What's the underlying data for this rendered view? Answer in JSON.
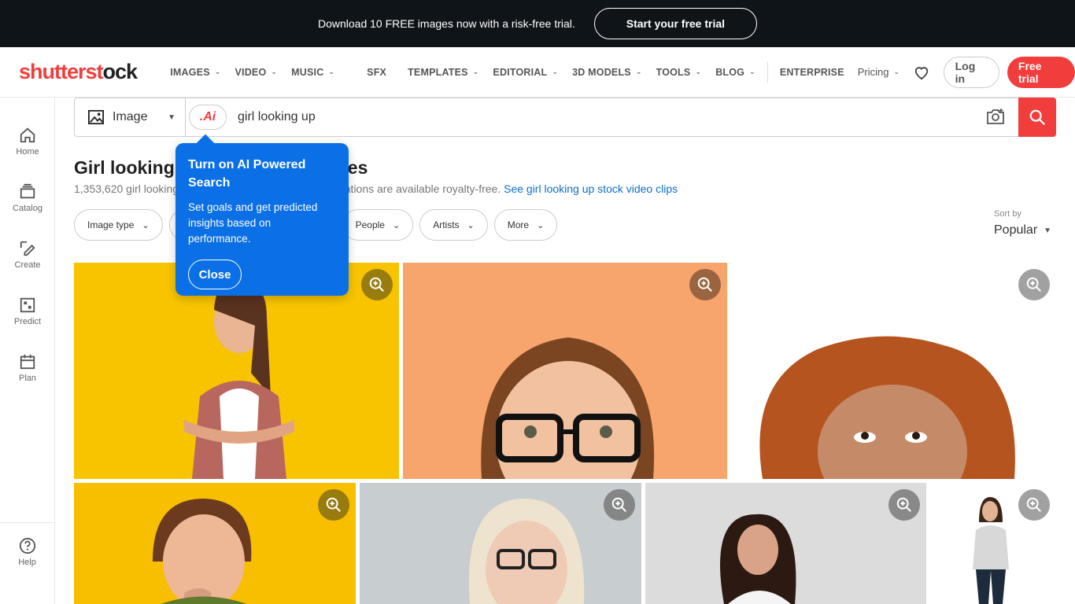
{
  "promo": {
    "text": "Download 10 FREE images now with a risk-free trial.",
    "button": "Start your free trial"
  },
  "header": {
    "logo_a": "shutterst",
    "logo_b": "o",
    "logo_c": "ck",
    "nav": [
      "IMAGES",
      "VIDEO",
      "MUSIC",
      "SFX",
      "TEMPLATES",
      "EDITORIAL",
      "3D MODELS",
      "TOOLS",
      "BLOG"
    ],
    "enterprise": "ENTERPRISE",
    "pricing": "Pricing",
    "login": "Log in",
    "free_trial": "Free trial"
  },
  "sidebar": {
    "items": [
      "Home",
      "Catalog",
      "Create",
      "Predict",
      "Plan"
    ],
    "help": "Help"
  },
  "search": {
    "type": "Image",
    "ai_label": ".Ai",
    "query": "girl looking up"
  },
  "results": {
    "title_start": "Girl looking",
    "title_end": "es",
    "subtitle_start": "1,353,620 girl looking",
    "subtitle_end": "rations are available royalty-free.",
    "video_link": "See girl looking up stock video clips"
  },
  "filters": [
    "Image type",
    "People",
    "Artists",
    "More"
  ],
  "sort": {
    "label": "Sort by",
    "value": "Popular"
  },
  "tooltip": {
    "title": "Turn on AI Powered Search",
    "body": "Set goals and get predicted insights based on performance.",
    "close": "Close"
  },
  "colors": {
    "brand": "#f23d3d",
    "tooltip": "#0b6fe6",
    "promo_bg": "#0f1419"
  }
}
